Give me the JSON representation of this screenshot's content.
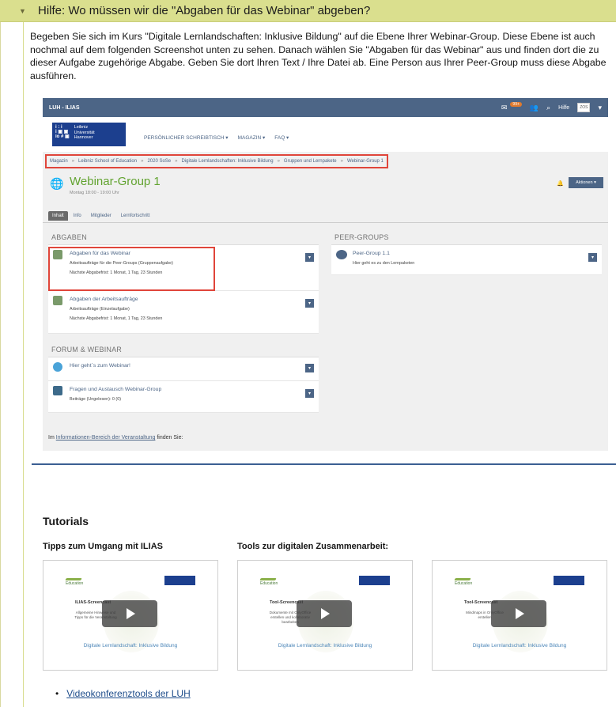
{
  "accordion": {
    "caret": "▼",
    "title": "Hilfe: Wo müssen wir die \"Abgaben für das Webinar\" abgeben?",
    "intro": "Begeben Sie sich im Kurs \"Digitale Lernlandschaften: Inklusive Bildung\" auf die Ebene Ihrer Webinar-Group. Diese Ebene ist auch nochmal auf dem folgenden Screenshot unten zu sehen. Danach wählen Sie \"Abgaben für das Webinar\" aus und finden dort die zu dieser Aufgabe zugehörige Abgabe. Geben Sie dort Ihren Text / Ihre Datei ab. Eine Person aus Ihrer Peer-Group muss diese Abgabe ausführen."
  },
  "screenshot": {
    "site_title": "LUH - ILIAS",
    "notification_count": "99+",
    "help_label": "Hilfe",
    "avatar_label": "ZOS",
    "logo_lines": [
      "Leibniz",
      "Universität",
      "Hannover"
    ],
    "logo_mark": "i : i\ni ⊠ ⊡\nio # ⊡",
    "nav": [
      "PERSÖNLICHER SCHREIBTISCH ▾",
      "MAGAZIN ▾",
      "FAQ ▾"
    ],
    "breadcrumbs": [
      "Magazin",
      "Leibniz School of Education",
      "2020 SoSe",
      "Digitale Lernlandschaften: Inklusive Bildung",
      "Gruppen und Lernpakete",
      "Webinar-Group 1"
    ],
    "breadcrumb_sep": "»",
    "page_title": "Webinar-Group 1",
    "page_subtitle": "Montag 18:00 - 19:00 Uhr",
    "actions_label": "Aktionen ▾",
    "tabs": [
      "Inhalt",
      "Info",
      "Mitglieder",
      "Lernfortschritt"
    ],
    "blocks": {
      "abgaben": {
        "title": "ABGABEN",
        "items": [
          {
            "title": "Abgaben für das Webinar",
            "desc1": "Arbeitsaufträge für die Peer-Groups (Gruppenaufgabe)",
            "desc2": "Nächste Abgabefrist: 1 Monat, 1 Tag, 23 Stunden"
          },
          {
            "title": "Abgaben der Arbeitsaufträge",
            "desc1": "Arbeitsaufträge (Einzelaufgabe)",
            "desc2": "Nächste Abgabefrist: 1 Monat, 1 Tag, 23 Stunden"
          }
        ]
      },
      "forum": {
        "title": "FORUM & WEBINAR",
        "items": [
          {
            "title": "Hier geht´s zum Webinar!",
            "desc1": ""
          },
          {
            "title": "Fragen und Austausch Webinar-Group",
            "desc1": "Beiträge (Ungelesen): 0 (0)"
          }
        ]
      },
      "peer": {
        "title": "PEER-GROUPS",
        "items": [
          {
            "title": "Peer-Group 1.1",
            "desc1": "Hier geht es zu den Lernpaketen"
          }
        ]
      }
    },
    "dropdown_glyph": "▾",
    "info_prefix": "Im ",
    "info_link": "Informationen-Bereich der Veranstaltung",
    "info_suffix": " finden Sie:"
  },
  "tutorials": {
    "heading": "Tutorials",
    "col1_heading": "Tipps zum Umgang mit ILIAS",
    "col2_heading": "Tools zur digitalen Zusammenarbeit:",
    "videos": [
      {
        "brand": "Education",
        "title": "ILIAS-Screencast",
        "desc": "Allgemeine Hinweise und Tipps für die Veranstaltung",
        "caption": "Digitale Lernlandschaft: Inklusive Bildung"
      },
      {
        "brand": "Education",
        "title": "Tool-Screencast",
        "desc": "Dokumente mit OnlyOffice erstellen und kollaborativ bearbeiten",
        "caption": "Digitale Lernlandschaft: Inklusive Bildung"
      },
      {
        "brand": "Education",
        "title": "Tool-Screencast",
        "desc": "Mindmaps in OnlyOffice erstellen",
        "caption": "Digitale Lernlandschaft: Inklusive Bildung"
      }
    ],
    "links": [
      {
        "bullet": "•",
        "label": "Videokonferenztools der LUH"
      }
    ]
  }
}
